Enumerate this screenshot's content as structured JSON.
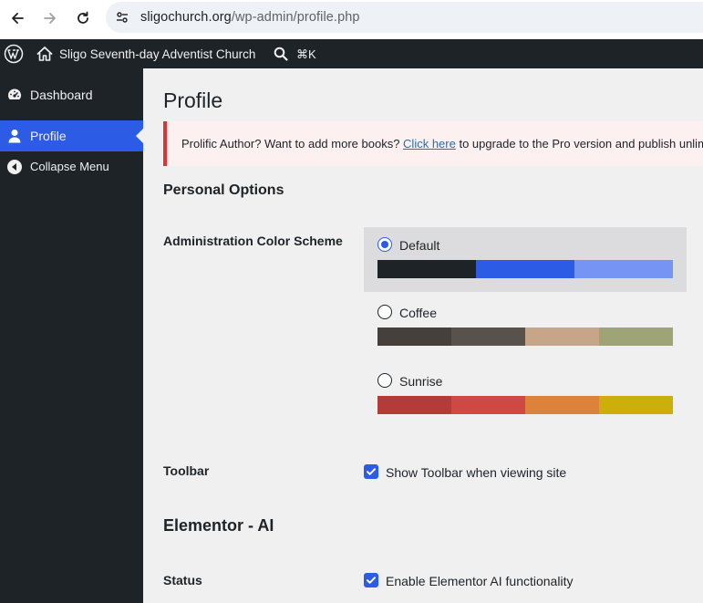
{
  "browser": {
    "url_host": "sligochurch.org",
    "url_path": "/wp-admin/profile.php"
  },
  "adminbar": {
    "site_name": "Sligo Seventh-day Adventist Church",
    "search_shortcut": "⌘K"
  },
  "sidebar": {
    "items": [
      {
        "label": "Dashboard",
        "icon": "dashboard-icon"
      },
      {
        "label": "Profile",
        "icon": "user-icon",
        "active": true
      },
      {
        "label": "Collapse Menu",
        "icon": "collapse-icon"
      }
    ]
  },
  "main": {
    "title": "Profile",
    "notice": {
      "before": "Prolific Author? Want to add more books? ",
      "link": "Click here",
      "after": " to upgrade to the Pro version and publish unlimited books."
    },
    "personal_options_heading": "Personal Options",
    "color_scheme_label": "Administration Color Scheme",
    "schemes": [
      {
        "name": "Default",
        "selected": true,
        "colors": [
          "#1d2327",
          "#2c5ce6",
          "#7594f3"
        ]
      },
      {
        "name": "Coffee",
        "selected": false,
        "colors": [
          "#46403c",
          "#59524c",
          "#c7a589",
          "#9ea476"
        ]
      },
      {
        "name": "Sunrise",
        "selected": false,
        "colors": [
          "#b43c38",
          "#cf4944",
          "#dd823b",
          "#ccaf0b"
        ]
      }
    ],
    "toolbar_label": "Toolbar",
    "toolbar_option": "Show Toolbar when viewing site",
    "elementor_heading": "Elementor - AI",
    "status_label": "Status",
    "status_option": "Enable Elementor AI functionality"
  }
}
